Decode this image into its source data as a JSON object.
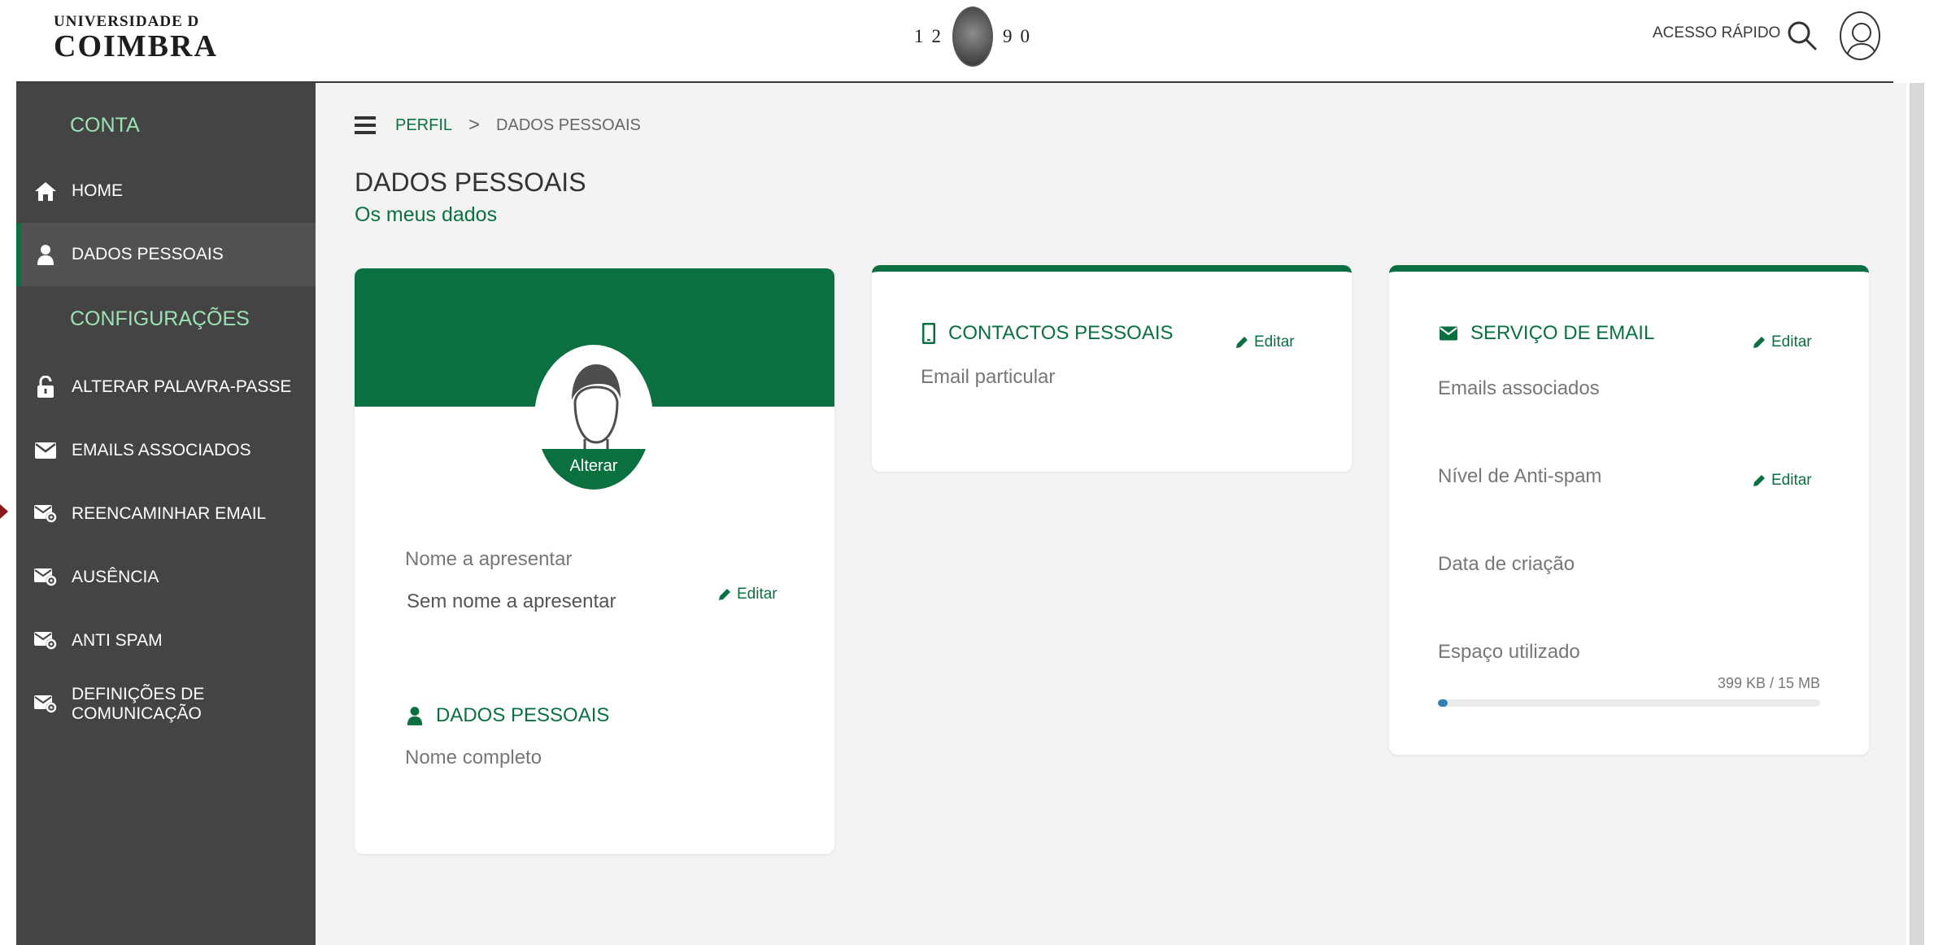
{
  "header": {
    "logo_top": "UNIVERSIDADE D",
    "logo_main": "COIMBRA",
    "year_left": "12",
    "year_right": "90",
    "quick_access": "ACESSO RÁPIDO"
  },
  "sidebar": {
    "section_account": "CONTA",
    "section_settings": "CONFIGURAÇÕES",
    "items": [
      {
        "label": "HOME",
        "icon": "home-icon"
      },
      {
        "label": "DADOS PESSOAIS",
        "icon": "user-icon",
        "active": true
      },
      {
        "label": "ALTERAR PALAVRA-PASSE",
        "icon": "unlock-icon"
      },
      {
        "label": "EMAILS ASSOCIADOS",
        "icon": "envelope-icon"
      },
      {
        "label": "REENCAMINHAR EMAIL",
        "icon": "mail-settings-icon"
      },
      {
        "label": "AUSÊNCIA",
        "icon": "mail-settings-icon"
      },
      {
        "label": "ANTI SPAM",
        "icon": "mail-settings-icon"
      },
      {
        "label": "DEFINIÇÕES DE COMUNICAÇÃO",
        "icon": "mail-settings-icon"
      }
    ]
  },
  "breadcrumb": {
    "link": "PERFIL",
    "separator": ">",
    "current": "DADOS PESSOAIS"
  },
  "page": {
    "title": "DADOS PESSOAIS",
    "subtitle": "Os meus dados"
  },
  "profile_card": {
    "change_photo": "Alterar",
    "display_name_label": "Nome a apresentar",
    "display_name_value": "Sem nome a apresentar",
    "edit": "Editar",
    "section_title": "DADOS PESSOAIS",
    "full_name_label": "Nome completo"
  },
  "contacts_card": {
    "title": "CONTACTOS PESSOAIS",
    "edit": "Editar",
    "email_label": "Email particular"
  },
  "email_card": {
    "title": "SERVIÇO DE EMAIL",
    "edit": "Editar",
    "associated_label": "Emails associados",
    "antispam_label": "Nível de Anti-spam",
    "antispam_edit": "Editar",
    "created_label": "Data de criação",
    "space_label": "Espaço utilizado",
    "space_value": "399 KB / 15 MB",
    "space_fraction": 0.026
  },
  "colors": {
    "brand_green": "#0b7040",
    "sidebar_bg": "#444444",
    "section_green": "#9be3b3",
    "progress_blue": "#2f7fb5"
  }
}
